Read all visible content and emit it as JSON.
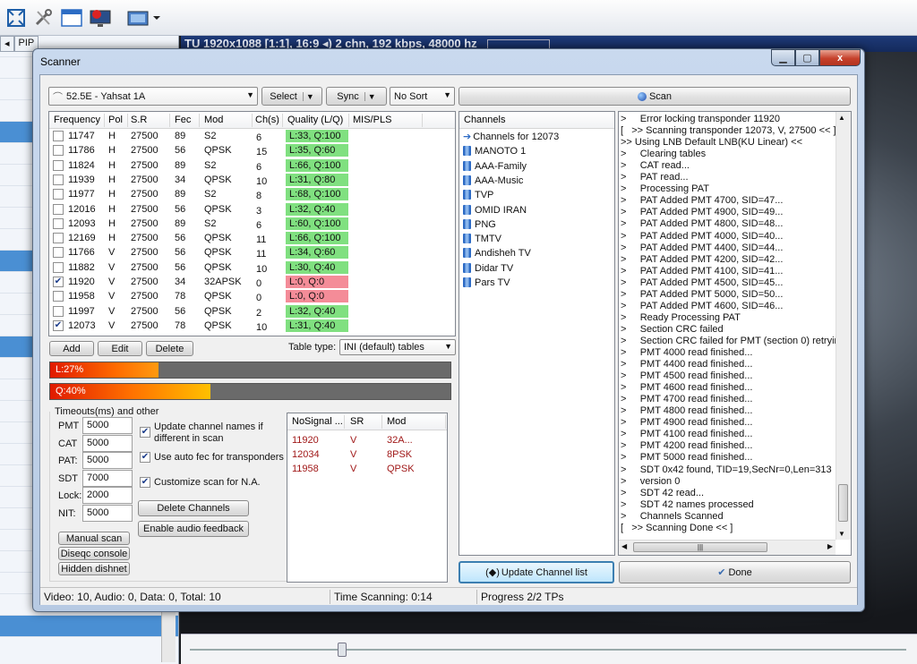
{
  "background": {
    "pip_tab": "PIP",
    "status_text": "1920x1088 [1:1], 16:9 ",
    "status_audio": "2 chn, 192 kbps, 48000 hz"
  },
  "window": {
    "title": "Scanner",
    "close_label": "x"
  },
  "toolbar": {
    "satellite": "52.5E -  Yahsat 1A",
    "select_label": "Select",
    "sync_label": "Sync",
    "sort_value": "No Sort",
    "scan_label": "Scan"
  },
  "freq_table": {
    "headers": [
      "Frequency",
      "Pol",
      "S.R",
      "Fec",
      "Mod",
      "Ch(s)",
      "Quality (L/Q)",
      "MIS/PLS"
    ],
    "rows": [
      {
        "checked": false,
        "freq": "11747",
        "pol": "H",
        "sr": "27500",
        "fec": "89",
        "mod": "S2",
        "ch": "6",
        "quality": "L:33, Q:100",
        "ok": true
      },
      {
        "checked": false,
        "freq": "11786",
        "pol": "H",
        "sr": "27500",
        "fec": "56",
        "mod": "QPSK",
        "ch": "15",
        "quality": "L:35, Q:60",
        "ok": true
      },
      {
        "checked": false,
        "freq": "11824",
        "pol": "H",
        "sr": "27500",
        "fec": "89",
        "mod": "S2",
        "ch": "6",
        "quality": "L:66, Q:100",
        "ok": true
      },
      {
        "checked": false,
        "freq": "11939",
        "pol": "H",
        "sr": "27500",
        "fec": "34",
        "mod": "QPSK",
        "ch": "10",
        "quality": "L:31, Q:80",
        "ok": true
      },
      {
        "checked": false,
        "freq": "11977",
        "pol": "H",
        "sr": "27500",
        "fec": "89",
        "mod": "S2",
        "ch": "8",
        "quality": "L:68, Q:100",
        "ok": true
      },
      {
        "checked": false,
        "freq": "12016",
        "pol": "H",
        "sr": "27500",
        "fec": "56",
        "mod": "QPSK",
        "ch": "3",
        "quality": "L:32, Q:40",
        "ok": true
      },
      {
        "checked": false,
        "freq": "12093",
        "pol": "H",
        "sr": "27500",
        "fec": "89",
        "mod": "S2",
        "ch": "6",
        "quality": "L:60, Q:100",
        "ok": true
      },
      {
        "checked": false,
        "freq": "12169",
        "pol": "H",
        "sr": "27500",
        "fec": "56",
        "mod": "QPSK",
        "ch": "11",
        "quality": "L:66, Q:100",
        "ok": true
      },
      {
        "checked": false,
        "freq": "11766",
        "pol": "V",
        "sr": "27500",
        "fec": "56",
        "mod": "QPSK",
        "ch": "11",
        "quality": "L:34, Q:60",
        "ok": true
      },
      {
        "checked": false,
        "freq": "11882",
        "pol": "V",
        "sr": "27500",
        "fec": "56",
        "mod": "QPSK",
        "ch": "10",
        "quality": "L:30, Q:40",
        "ok": true
      },
      {
        "checked": true,
        "freq": "11920",
        "pol": "V",
        "sr": "27500",
        "fec": "34",
        "mod": "32APSK",
        "ch": "0",
        "quality": "L:0, Q:0",
        "ok": false
      },
      {
        "checked": false,
        "freq": "11958",
        "pol": "V",
        "sr": "27500",
        "fec": "78",
        "mod": "QPSK",
        "ch": "0",
        "quality": "L:0, Q:0",
        "ok": false
      },
      {
        "checked": false,
        "freq": "11997",
        "pol": "V",
        "sr": "27500",
        "fec": "56",
        "mod": "QPSK",
        "ch": "2",
        "quality": "L:32, Q:40",
        "ok": true
      },
      {
        "checked": true,
        "freq": "12073",
        "pol": "V",
        "sr": "27500",
        "fec": "78",
        "mod": "QPSK",
        "ch": "10",
        "quality": "L:31, Q:40",
        "ok": true
      }
    ]
  },
  "table_actions": {
    "add": "Add",
    "edit": "Edit",
    "delete": "Delete",
    "table_type_label": "Table type:",
    "table_type_value": "INI (default) tables"
  },
  "levels": {
    "level_label": "L:27%",
    "level_fraction": 0.27,
    "quality_label": "Q:40%",
    "quality_fraction": 0.4
  },
  "timeouts": {
    "title": "Timeouts(ms) and other",
    "fields": [
      {
        "label": "PMT",
        "value": "5000"
      },
      {
        "label": "CAT",
        "value": "5000"
      },
      {
        "label": "PAT:",
        "value": "5000"
      },
      {
        "label": "SDT",
        "value": "7000"
      },
      {
        "label": "Lock:",
        "value": "2000"
      },
      {
        "label": "NIT:",
        "value": "5000"
      }
    ],
    "options": [
      {
        "label": "Update channel names if",
        "label2": "different in scan",
        "checked": true
      },
      {
        "label": "Use auto fec for transponders",
        "checked": true
      },
      {
        "label": "Customize scan for N.A.",
        "checked": true
      }
    ],
    "delete_channels": "Delete Channels",
    "audio_feedback": "Enable audio feedback",
    "manual_scan": "Manual scan",
    "diseqc_console": "Diseqc console",
    "hidden_dishnet": "Hidden dishnet"
  },
  "nosignal": {
    "headers": [
      "NoSignal ...",
      "SR",
      "Mod"
    ],
    "rows": [
      {
        "freq": "11920",
        "sr": "V",
        "mod": "32A..."
      },
      {
        "freq": "12034",
        "sr": "V",
        "mod": "8PSK"
      },
      {
        "freq": "11958",
        "sr": "V",
        "mod": "QPSK"
      }
    ]
  },
  "channels": {
    "header": "Channels",
    "items": [
      "Channels for 12073",
      "MANOTO 1",
      "AAA-Family",
      "AAA-Music",
      "TVP",
      "OMID IRAN",
      "PNG",
      "TMTV",
      "Andisheh TV",
      "Didar TV",
      "Pars TV"
    ]
  },
  "log": {
    "lines": [
      ">     Error locking transponder 11920",
      "[   >> Scanning transponder 12073, V, 27500 << ]",
      ">> Using LNB Default LNB(KU Linear) <<",
      ">     Clearing tables",
      ">     CAT read...",
      ">     PAT read...",
      ">     Processing PAT",
      ">     PAT Added PMT 4700, SID=47...",
      ">     PAT Added PMT 4900, SID=49...",
      ">     PAT Added PMT 4800, SID=48...",
      ">     PAT Added PMT 4000, SID=40...",
      ">     PAT Added PMT 4400, SID=44...",
      ">     PAT Added PMT 4200, SID=42...",
      ">     PAT Added PMT 4100, SID=41...",
      ">     PAT Added PMT 4500, SID=45...",
      ">     PAT Added PMT 5000, SID=50...",
      ">     PAT Added PMT 4600, SID=46...",
      ">     Ready Processing PAT",
      ">     Section CRC failed",
      ">     Section CRC failed for PMT (section 0) retryin",
      ">     PMT 4000 read finished...",
      ">     PMT 4400 read finished...",
      ">     PMT 4500 read finished...",
      ">     PMT 4600 read finished...",
      ">     PMT 4700 read finished...",
      ">     PMT 4800 read finished...",
      ">     PMT 4900 read finished...",
      ">     PMT 4100 read finished...",
      ">     PMT 4200 read finished...",
      ">     PMT 5000 read finished...",
      ">     SDT 0x42 found, TID=19,SecNr=0,Len=313",
      ">     version 0",
      ">     SDT 42 read...",
      ">     SDT 42 names processed",
      ">     Channels Scanned",
      "[   >> Scanning Done << ]"
    ]
  },
  "bottom_buttons": {
    "update": "Update Channel list",
    "done": "Done"
  },
  "status": {
    "counts": "Video: 10, Audio: 0, Data: 0, Total: 10",
    "time": "Time Scanning: 0:14",
    "progress": "Progress 2/2 TPs"
  }
}
